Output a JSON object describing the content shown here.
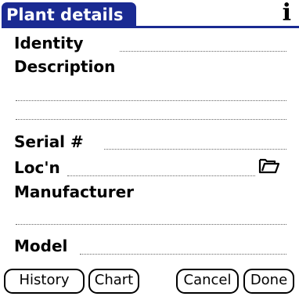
{
  "form": {
    "title": "Plant details",
    "info_glyph": "i",
    "fields": {
      "identity_label": "Identity",
      "identity_value": "",
      "description_label": "Description",
      "description_line1": "",
      "description_line2": "",
      "serial_label": "Serial #",
      "serial_value": "",
      "location_label": "Loc'n",
      "location_value": "",
      "manufacturer_label": "Manufacturer",
      "manufacturer_value": "",
      "model_label": "Model",
      "model_value": ""
    },
    "icons": {
      "info": "info-icon",
      "location_picker": "folder-icon"
    }
  },
  "buttons": {
    "history": "History",
    "chart": "Chart",
    "cancel": "Cancel",
    "done": "Done"
  },
  "colors": {
    "title_bar": "#1a2a92"
  }
}
